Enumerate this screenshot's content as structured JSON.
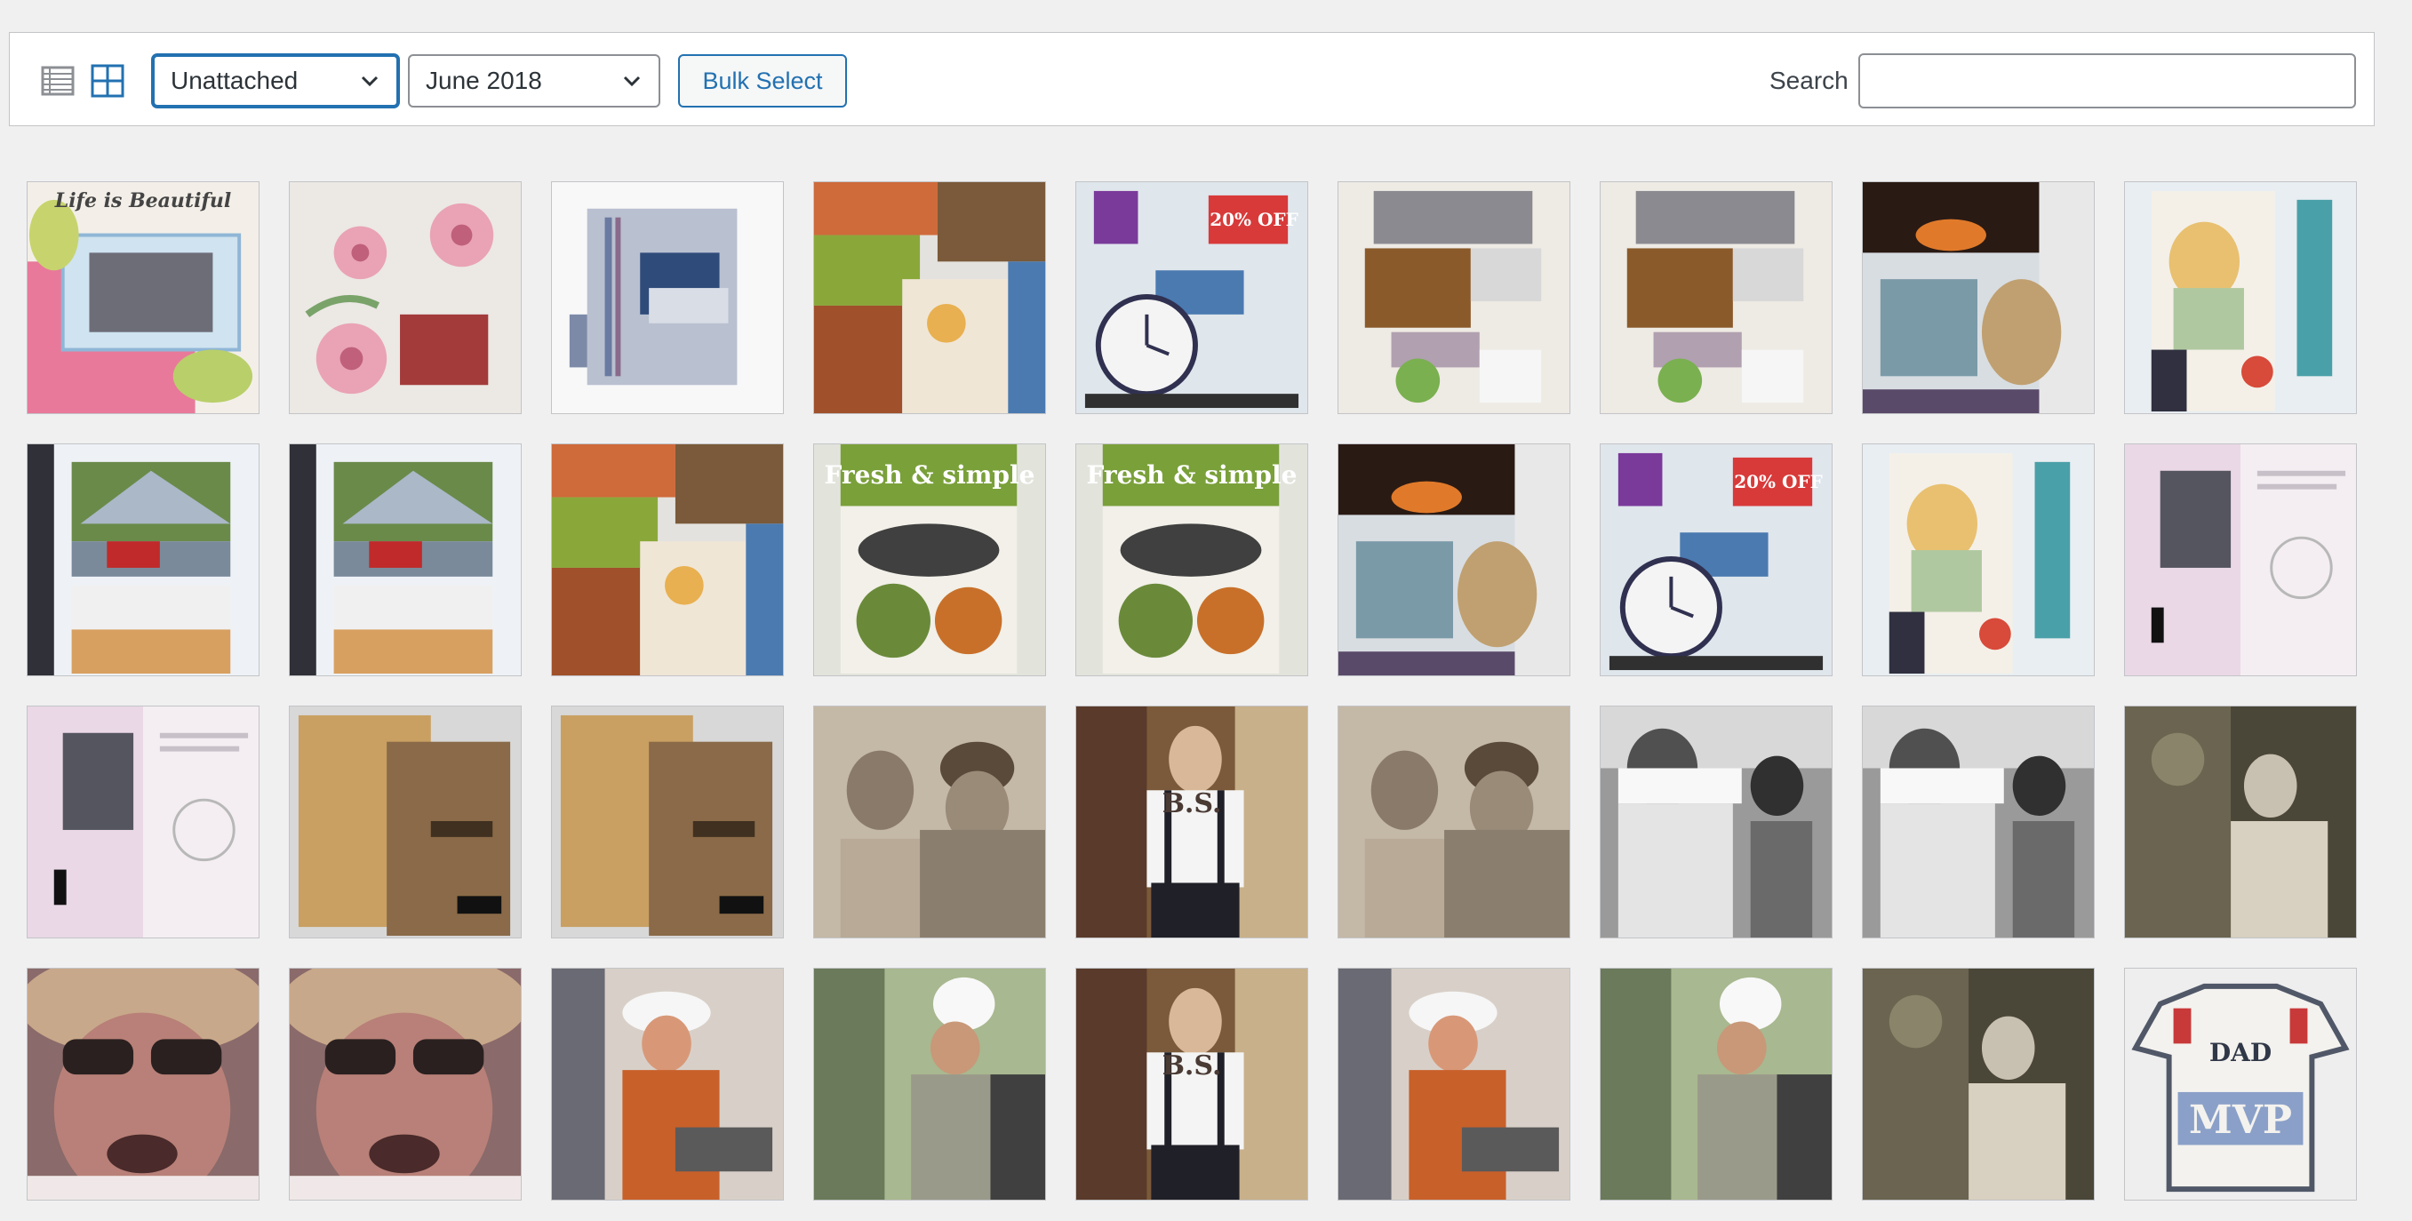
{
  "toolbar": {
    "view_list_icon": "list-view-icon",
    "view_grid_icon": "grid-view-icon",
    "type_filter": {
      "selected": "Unattached"
    },
    "date_filter": {
      "selected": "June 2018"
    },
    "bulk_select_label": "Bulk Select",
    "search_label": "Search",
    "search_value": ""
  },
  "colors": {
    "accent": "#2271b1",
    "border": "#8c8f94",
    "background": "#f0f0f1"
  },
  "media": [
    {
      "kind": "scrapbook-life",
      "caption": "Life is Beautiful"
    },
    {
      "kind": "scrapbook-flowers"
    },
    {
      "kind": "scrapbook-card"
    },
    {
      "kind": "collage-fresh"
    },
    {
      "kind": "collage-money",
      "caption": "20% OFF"
    },
    {
      "kind": "collage-home"
    },
    {
      "kind": "collage-home"
    },
    {
      "kind": "collage-campfire"
    },
    {
      "kind": "collage-create"
    },
    {
      "kind": "collage-road"
    },
    {
      "kind": "collage-road"
    },
    {
      "kind": "collage-fresh"
    },
    {
      "kind": "collage-fresh2",
      "caption": "Fresh & simple"
    },
    {
      "kind": "collage-fresh2",
      "caption": "Fresh & simple"
    },
    {
      "kind": "collage-campfire"
    },
    {
      "kind": "collage-money",
      "caption": "20% OFF"
    },
    {
      "kind": "collage-create"
    },
    {
      "kind": "book-page"
    },
    {
      "kind": "book-page"
    },
    {
      "kind": "sketchbook"
    },
    {
      "kind": "sketchbook"
    },
    {
      "kind": "photo-couple"
    },
    {
      "kind": "photo-bs",
      "caption": "B.S."
    },
    {
      "kind": "photo-couple"
    },
    {
      "kind": "photo-cake"
    },
    {
      "kind": "photo-cake"
    },
    {
      "kind": "photo-garden"
    },
    {
      "kind": "photo-face"
    },
    {
      "kind": "photo-face"
    },
    {
      "kind": "photo-cowboy"
    },
    {
      "kind": "photo-chef"
    },
    {
      "kind": "photo-bs",
      "caption": "B.S."
    },
    {
      "kind": "photo-cowboy"
    },
    {
      "kind": "photo-chef"
    },
    {
      "kind": "photo-garden"
    },
    {
      "kind": "shirt-mvp",
      "caption": "DAD",
      "caption2": "MVP"
    }
  ]
}
